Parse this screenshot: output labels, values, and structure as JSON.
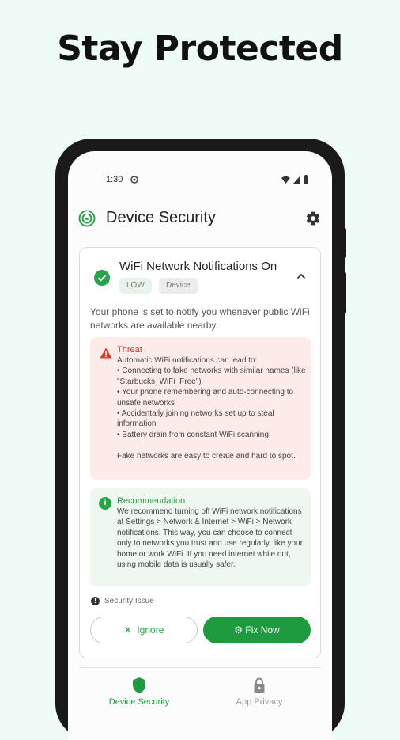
{
  "promo": {
    "headline": "Stay Protected"
  },
  "status_bar": {
    "time": "1:30"
  },
  "app_bar": {
    "title": "Device Security"
  },
  "issue_card": {
    "title": "WiFi Network Notifications On",
    "tags": [
      "LOW",
      "Device"
    ],
    "description": "Your phone is set to notify you whenever public WiFi networks are available nearby.",
    "threat": {
      "label": "Threat",
      "body": "Automatic WiFi notifications can lead to:\n• Connecting to fake networks with similar names (like \"Starbucks_WiFi_Free\")\n• Your phone remembering and auto-connecting to unsafe networks\n• Accidentally joining networks set up to steal information\n• Battery drain from constant WiFi scanning\n\nFake networks are easy to create and hard to spot."
    },
    "recommendation": {
      "label": "Recommendation",
      "body": "We recommend turning off WiFi network notifications at Settings > Network & Internet > WiFi > Network notifications. This way, you can choose to connect only to networks you trust and use regularly, like your home or work WiFi. If you need internet while out, using mobile data is usually safer."
    },
    "footer_label": "Security Issue",
    "ignore_label": "Ignore",
    "fix_label": "Fix Now"
  },
  "bottom_nav": [
    {
      "label": "Device Security",
      "active": true
    },
    {
      "label": "App Privacy",
      "active": false
    }
  ],
  "colors": {
    "accent": "#1e9b3f",
    "threat_bg": "#fdebe9",
    "threat_text": "#d33a2c",
    "rec_bg": "#eef7f0",
    "page_bg": "#effbf6"
  }
}
